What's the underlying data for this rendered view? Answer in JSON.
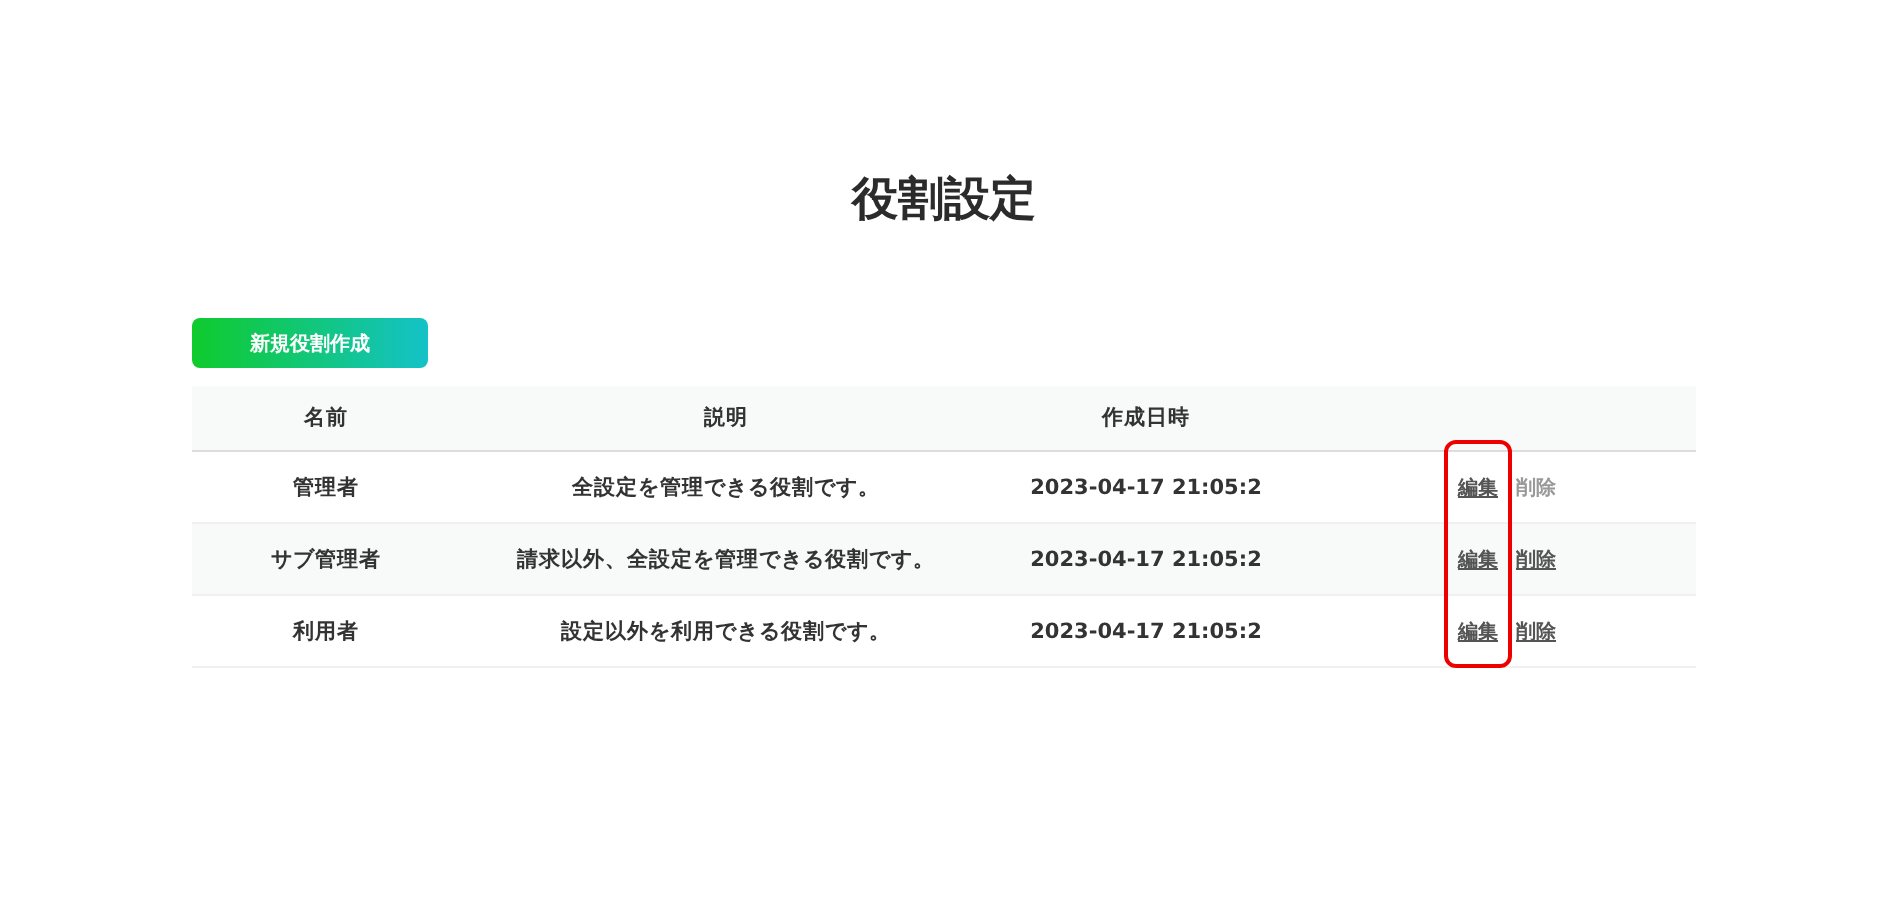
{
  "title": "役割設定",
  "create_button": "新規役割作成",
  "table": {
    "columns": [
      "名前",
      "説明",
      "作成日時"
    ],
    "rows": [
      {
        "name": "管理者",
        "description": "全設定を管理できる役割です。",
        "created": "2023-04-17 21:05:2",
        "edit": "編集",
        "delete": {
          "label": "削除",
          "disabled": true
        }
      },
      {
        "name": "サブ管理者",
        "description": "請求以外、全設定を管理できる役割です。",
        "created": "2023-04-17 21:05:2",
        "edit": "編集",
        "delete": {
          "label": "削除",
          "disabled": false
        }
      },
      {
        "name": "利用者",
        "description": "設定以外を利用できる役割です。",
        "created": "2023-04-17 21:05:2",
        "edit": "編集",
        "delete": {
          "label": "削除",
          "disabled": false
        }
      }
    ],
    "edit_highlighted": true
  }
}
